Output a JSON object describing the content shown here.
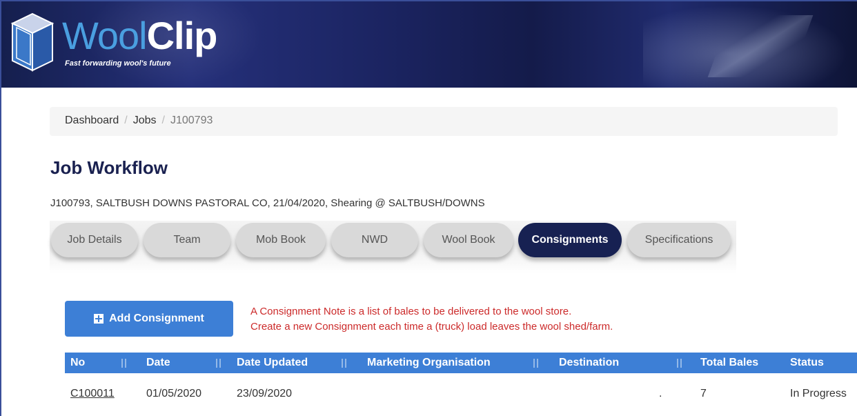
{
  "brand": {
    "name_part1": "Wool",
    "name_part2": "Clip",
    "tagline": "Fast forwarding wool's future"
  },
  "breadcrumb": {
    "items": [
      "Dashboard",
      "Jobs",
      "J100793"
    ]
  },
  "page": {
    "title": "Job Workflow",
    "summary": "J100793, SALTBUSH DOWNS PASTORAL CO, 21/04/2020, Shearing @ SALTBUSH/DOWNS"
  },
  "tabs": [
    {
      "label": "Job Details",
      "active": false
    },
    {
      "label": "Team",
      "active": false
    },
    {
      "label": "Mob Book",
      "active": false
    },
    {
      "label": "NWD",
      "active": false
    },
    {
      "label": "Wool Book",
      "active": false
    },
    {
      "label": "Consignments",
      "active": true
    },
    {
      "label": "Specifications",
      "active": false
    }
  ],
  "actions": {
    "add_consignment_label": "Add Consignment",
    "add_icon": "plus-square-icon"
  },
  "note": {
    "line1": "A Consignment Note is a list of bales to be delivered to the wool store.",
    "line2": "Create a new Consignment each time a (truck) load leaves the wool shed/farm."
  },
  "table": {
    "columns": [
      "No",
      "Date",
      "Date Updated",
      "Marketing Organisation",
      "Destination",
      "Total Bales",
      "Status"
    ],
    "rows": [
      {
        "no": "C100011",
        "date": "01/05/2020",
        "date_updated": "23/09/2020",
        "marketing_org": "",
        "destination": ".",
        "total_bales": "7",
        "status": "In Progress"
      }
    ]
  },
  "colors": {
    "header_bg": "#1b2461",
    "accent_blue": "#3d7fd6",
    "active_tab": "#172152",
    "note_red": "#cc2a2a",
    "title_navy": "#1a2150"
  }
}
